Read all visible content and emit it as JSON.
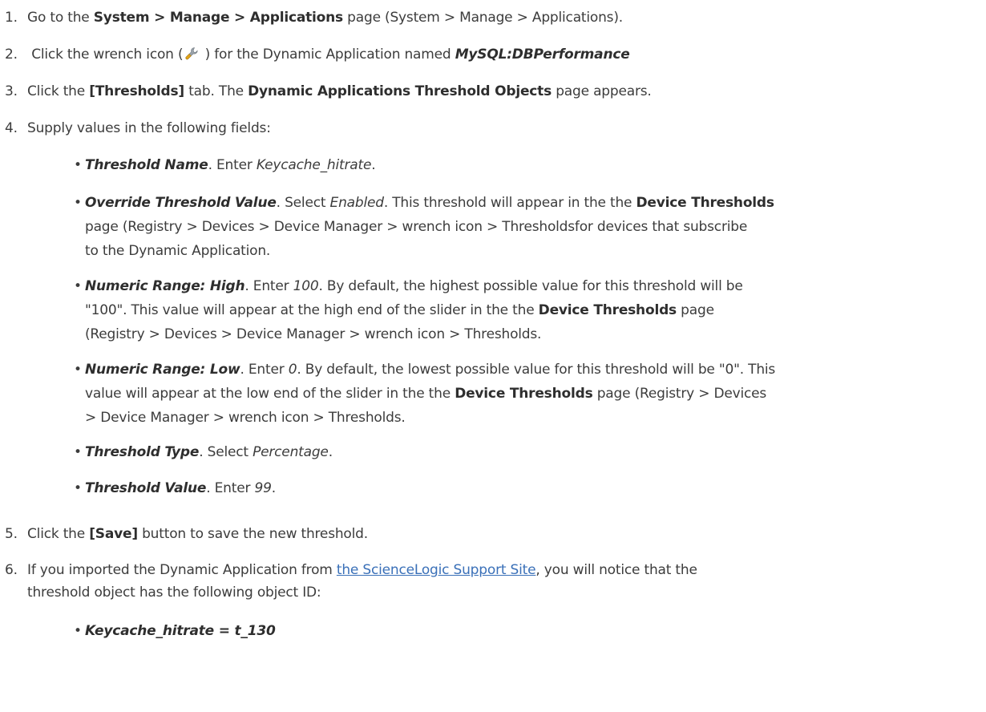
{
  "steps": {
    "s1": {
      "num": "1.",
      "a": "Go to the ",
      "b_nav": "System > Manage > Applications",
      "c": " page (System > Manage > Applications)."
    },
    "s2": {
      "num": "2.",
      "a": " Click the wrench icon (",
      "icon": "wrench-icon",
      "b": " ) for the Dynamic Application named ",
      "app": "MySQL:DBPerformance"
    },
    "s3": {
      "num": "3.",
      "a": "Click the ",
      "tab": "[Thresholds]",
      "b": " tab. The ",
      "page": "Dynamic Applications Threshold Objects",
      "c": " page appears."
    },
    "s4": {
      "num": "4.",
      "a": "Supply values in the following fields:"
    },
    "s5": {
      "num": "5.",
      "a": "Click the ",
      "btn": "[Save]",
      "b": " button to save the new threshold."
    },
    "s6": {
      "num": "6.",
      "a": "If you imported the Dynamic Application from ",
      "link": "the ScienceLogic Support Site",
      "b": ", you will notice that the",
      "c": "threshold object has the following object ID:"
    }
  },
  "fields": {
    "f1": {
      "label": "Threshold Name",
      "a": ". Enter ",
      "val": "Keycache_hitrate",
      "b": "."
    },
    "f2": {
      "label": "Override Threshold Value",
      "a": ". Select ",
      "val": "Enabled",
      "b": ". This threshold will appear in the the ",
      "page": "Device Thresholds",
      "c": "page (Registry > Devices > Device Manager > wrench icon > Thresholdsfor devices that subscribe",
      "d": "to the Dynamic Application."
    },
    "f3": {
      "label": "Numeric Range: High",
      "a": ". Enter ",
      "val": "100",
      "b": ". By default, the highest possible value for this threshold will be",
      "c": "\"100\". This value will appear at the high end of the slider in the the ",
      "page": "Device Thresholds",
      "d": " page",
      "e": "(Registry > Devices > Device Manager > wrench icon > Thresholds."
    },
    "f4": {
      "label": "Numeric Range: Low",
      "a": ". Enter ",
      "val": "0",
      "b": ". By default, the lowest possible value for this threshold will be \"0\". This",
      "c": "value will appear at the low end of the slider in the the ",
      "page": "Device Thresholds",
      "d": " page (Registry > Devices",
      "e": "> Device Manager > wrench icon > Thresholds."
    },
    "f5": {
      "label": "Threshold Type",
      "a": ". Select ",
      "val": "Percentage",
      "b": "."
    },
    "f6": {
      "label": "Threshold Value",
      "a": ". Enter ",
      "val": "99",
      "b": "."
    }
  },
  "object_id": {
    "text": "Keycache_hitrate = t_130"
  },
  "colors": {
    "text": "#3c3c3c",
    "link": "#3a70b8",
    "icon_metal": "#9aa3ab",
    "icon_gold": "#e2a419"
  }
}
